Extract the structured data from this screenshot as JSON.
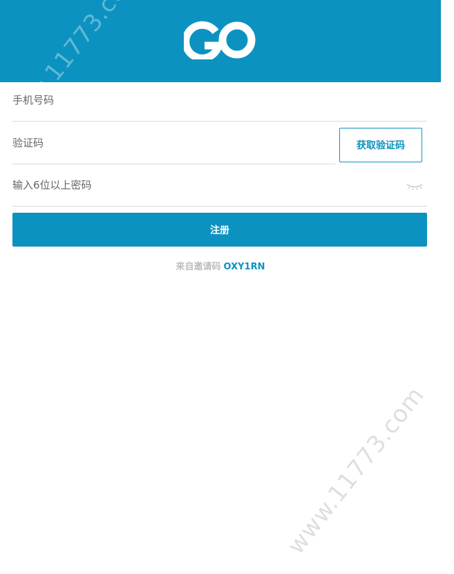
{
  "header": {
    "logo_text": "GO",
    "logo_icon": "go-logo-icon"
  },
  "form": {
    "phone_placeholder": "手机号码",
    "code_placeholder": "验证码",
    "get_code_label": "获取验证码",
    "password_placeholder": "输入6位以上密码",
    "eye_icon": "eye-closed-icon",
    "register_label": "注册"
  },
  "invite": {
    "label": "来自邀请码",
    "code": "OXY1RN"
  },
  "watermark": {
    "text": "www.11773.com"
  },
  "colors": {
    "brand": "#0c92c0",
    "muted": "#bdbdbd"
  }
}
